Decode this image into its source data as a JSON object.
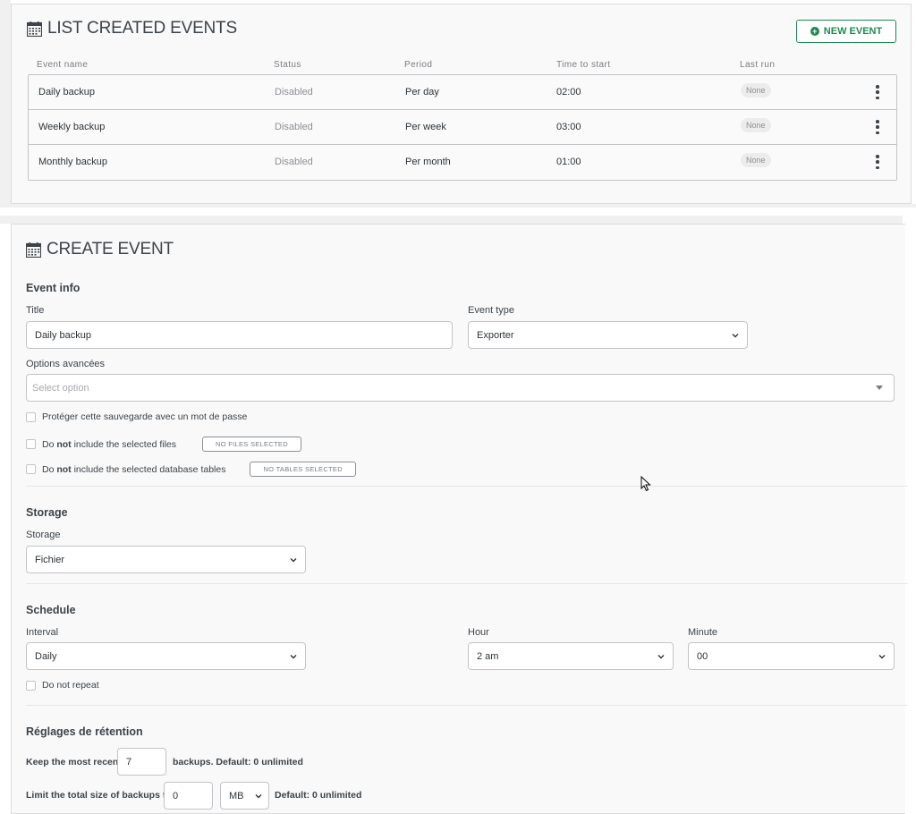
{
  "events_panel": {
    "title": "LIST CREATED EVENTS",
    "new_event_button": "NEW EVENT",
    "columns": [
      "Event name",
      "Status",
      "Period",
      "Time to start",
      "Last run"
    ],
    "rows": [
      {
        "name": "Daily backup",
        "status": "Disabled",
        "period": "Per day",
        "time": "02:00",
        "last_run": "None"
      },
      {
        "name": "Weekly backup",
        "status": "Disabled",
        "period": "Per week",
        "time": "03:00",
        "last_run": "None"
      },
      {
        "name": "Monthly backup",
        "status": "Disabled",
        "period": "Per month",
        "time": "01:00",
        "last_run": "None"
      }
    ]
  },
  "create_panel": {
    "title": "CREATE EVENT",
    "event_info": {
      "heading": "Event info",
      "title_label": "Title",
      "title_value": "Daily backup",
      "type_label": "Event type",
      "type_value": "Exporter",
      "advanced_label": "Options avancées",
      "advanced_placeholder": "Select option",
      "protect_label": "Protéger cette sauvegarde avec un mot de passe",
      "exclude_files": {
        "pre": "Do ",
        "strong": "not",
        "post": " include the selected files",
        "pill": "NO FILES SELECTED"
      },
      "exclude_tables": {
        "pre": "Do ",
        "strong": "not",
        "post": " include the selected database tables",
        "pill": "NO TABLES SELECTED"
      }
    },
    "storage": {
      "heading": "Storage",
      "label": "Storage",
      "value": "Fichier"
    },
    "schedule": {
      "heading": "Schedule",
      "interval_label": "Interval",
      "interval_value": "Daily",
      "hour_label": "Hour",
      "hour_value": "2 am",
      "minute_label": "Minute",
      "minute_value": "00",
      "no_repeat_label": "Do not repeat"
    },
    "retention": {
      "heading": "Réglages de rétention",
      "keep_label": "Keep the most recent",
      "keep_value": "7",
      "keep_suffix": "backups. Default: 0 unlimited",
      "limit_label": "Limit the total size of backups to",
      "limit_value": "0",
      "limit_unit": "MB",
      "limit_suffix": "Default: 0 unlimited"
    }
  }
}
